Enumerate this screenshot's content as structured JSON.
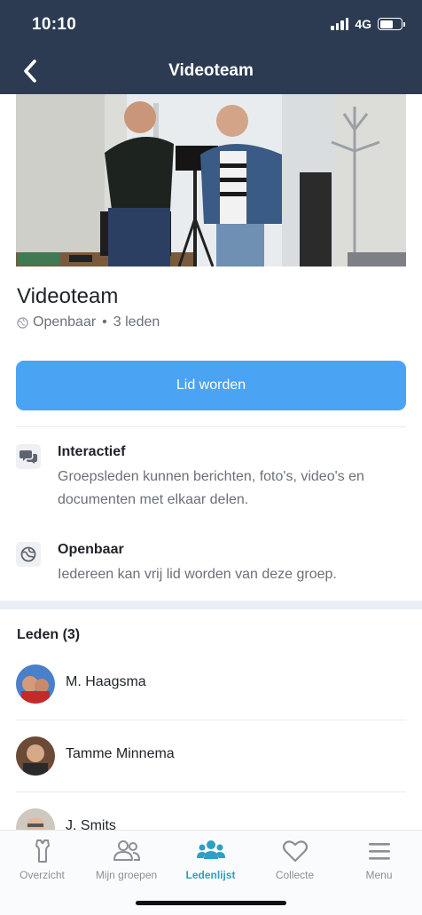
{
  "status_bar": {
    "time": "10:10",
    "network": "4G"
  },
  "nav": {
    "title": "Videoteam",
    "back_icon": "chevron-left-icon"
  },
  "group": {
    "name": "Videoteam",
    "visibility": "Openbaar",
    "separator": "•",
    "member_count_label": "3 leden",
    "join_label": "Lid worden"
  },
  "features": [
    {
      "icon": "chat-bubbles-icon",
      "title": "Interactief",
      "description": "Groepsleden kunnen berichten, foto's, video's en documenten met elkaar delen."
    },
    {
      "icon": "globe-icon",
      "title": "Openbaar",
      "description": "Iedereen kan vrij lid worden van deze groep."
    }
  ],
  "members": {
    "title": "Leden (3)",
    "items": [
      {
        "name": "M. Haagsma"
      },
      {
        "name": "Tamme Minnema"
      },
      {
        "name": "J. Smits"
      }
    ]
  },
  "tabbar": {
    "items": [
      {
        "label": "Overzicht",
        "icon": "shirt-icon"
      },
      {
        "label": "Mijn groepen",
        "icon": "people-icon"
      },
      {
        "label": "Ledenlijst",
        "icon": "members-icon",
        "active": true
      },
      {
        "label": "Collecte",
        "icon": "heart-icon"
      },
      {
        "label": "Menu",
        "icon": "hamburger-icon"
      }
    ]
  },
  "colors": {
    "header": "#2c3b52",
    "accent": "#4aa3f3",
    "active_tab": "#2f9fc4",
    "section_band": "#e9eef6"
  }
}
